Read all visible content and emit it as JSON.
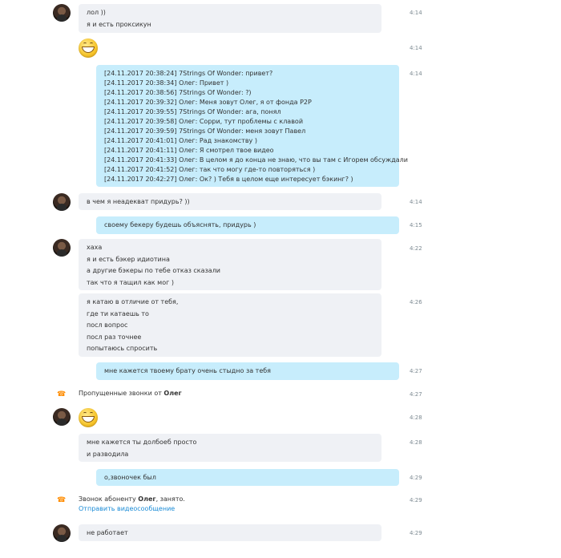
{
  "messages": {
    "m1": {
      "lines": [
        "лол ))",
        "я и есть проксикун"
      ],
      "time": "4:14"
    },
    "m2": {
      "time": "4:14",
      "emoji": "laughing-emoji"
    },
    "m3": {
      "lines": [
        "[24.11.2017 20:38:24] 7Strings Of Wonder: привет?",
        "[24.11.2017 20:38:34] Олег: Привет )",
        "[24.11.2017 20:38:56] 7Strings Of Wonder: ?)",
        "[24.11.2017 20:39:32] Олег: Меня зовут Олег, я от фонда P2P",
        "[24.11.2017 20:39:55] 7Strings Of Wonder: ага, понял",
        "[24.11.2017 20:39:58] Олег: Сорри, тут проблемы с клавой",
        "[24.11.2017 20:39:59] 7Strings Of Wonder: меня зовут Павел",
        "[24.11.2017 20:41:01] Олег: Рад знакомству )",
        "[24.11.2017 20:41:11] Олег: Я смотрел твое видео",
        "[24.11.2017 20:41:33] Олег: В целом я до конца не знаю, что вы там с Игорем обсуждали",
        "[24.11.2017 20:41:52] Олег: так что могу где-то повторяться )",
        "[24.11.2017 20:42:27] Олег: Ок? ) Тебя в целом еще интересует бэкинг? )"
      ],
      "time": "4:14"
    },
    "m4": {
      "lines": [
        "в чем я неадекват придурь? ))"
      ],
      "time": "4:14"
    },
    "m5": {
      "lines": [
        "своему бекеру будешь объяснять, придурь )"
      ],
      "time": "4:15"
    },
    "m6": {
      "lines": [
        "хаха",
        "я и есть бэкер идиотина",
        "а другие бэкеры по тебе отказ сказали",
        "так что я тащил как мог )"
      ],
      "time": "4:22"
    },
    "m7": {
      "lines": [
        "я катаю в отличие от тебя,",
        "где ти катаешь то",
        "посл вопрос",
        "посл раз точнее",
        "попытаюсь спросить"
      ],
      "time": "4:26"
    },
    "m8": {
      "lines": [
        "мне кажется твоему брату очень стыдно за тебя"
      ],
      "time": "4:27"
    },
    "m9": {
      "text": "Пропущенные звонки от ",
      "name": "Олег",
      "time": "4:27"
    },
    "m10": {
      "time": "4:28",
      "emoji": "laughing-emoji"
    },
    "m11": {
      "lines": [
        "мне кажется ты долбоеб просто",
        "и разводила"
      ],
      "time": "4:28"
    },
    "m12": {
      "lines": [
        "о,звоночек был"
      ],
      "time": "4:29"
    },
    "m13": {
      "text_before": "Звонок абоненту ",
      "name": "Олег",
      "text_after": ", занято.",
      "link": "Отправить видеосообщение",
      "time": "4:29"
    },
    "m14": {
      "lines": [
        "не работает"
      ],
      "time": "4:29"
    }
  },
  "colors": {
    "incoming_bubble": "#eff1f5",
    "outgoing_bubble": "#c7edfc",
    "link": "#1a8bd6",
    "call_icon": "#ff8c00"
  }
}
